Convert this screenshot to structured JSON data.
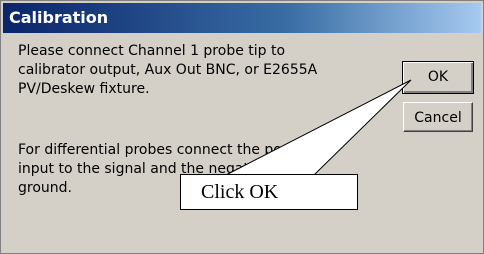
{
  "dialog": {
    "title": "Calibration",
    "message_1": "Please connect Channel 1 probe tip to\ncalibrator output, Aux Out BNC, or E2655A\nPV/Deskew fixture.",
    "message_2": "For differential probes connect the positive\ninput to the signal and the negative to\nground.",
    "ok_label": "OK",
    "cancel_label": "Cancel"
  },
  "annotation": {
    "callout_text": "Click OK"
  }
}
